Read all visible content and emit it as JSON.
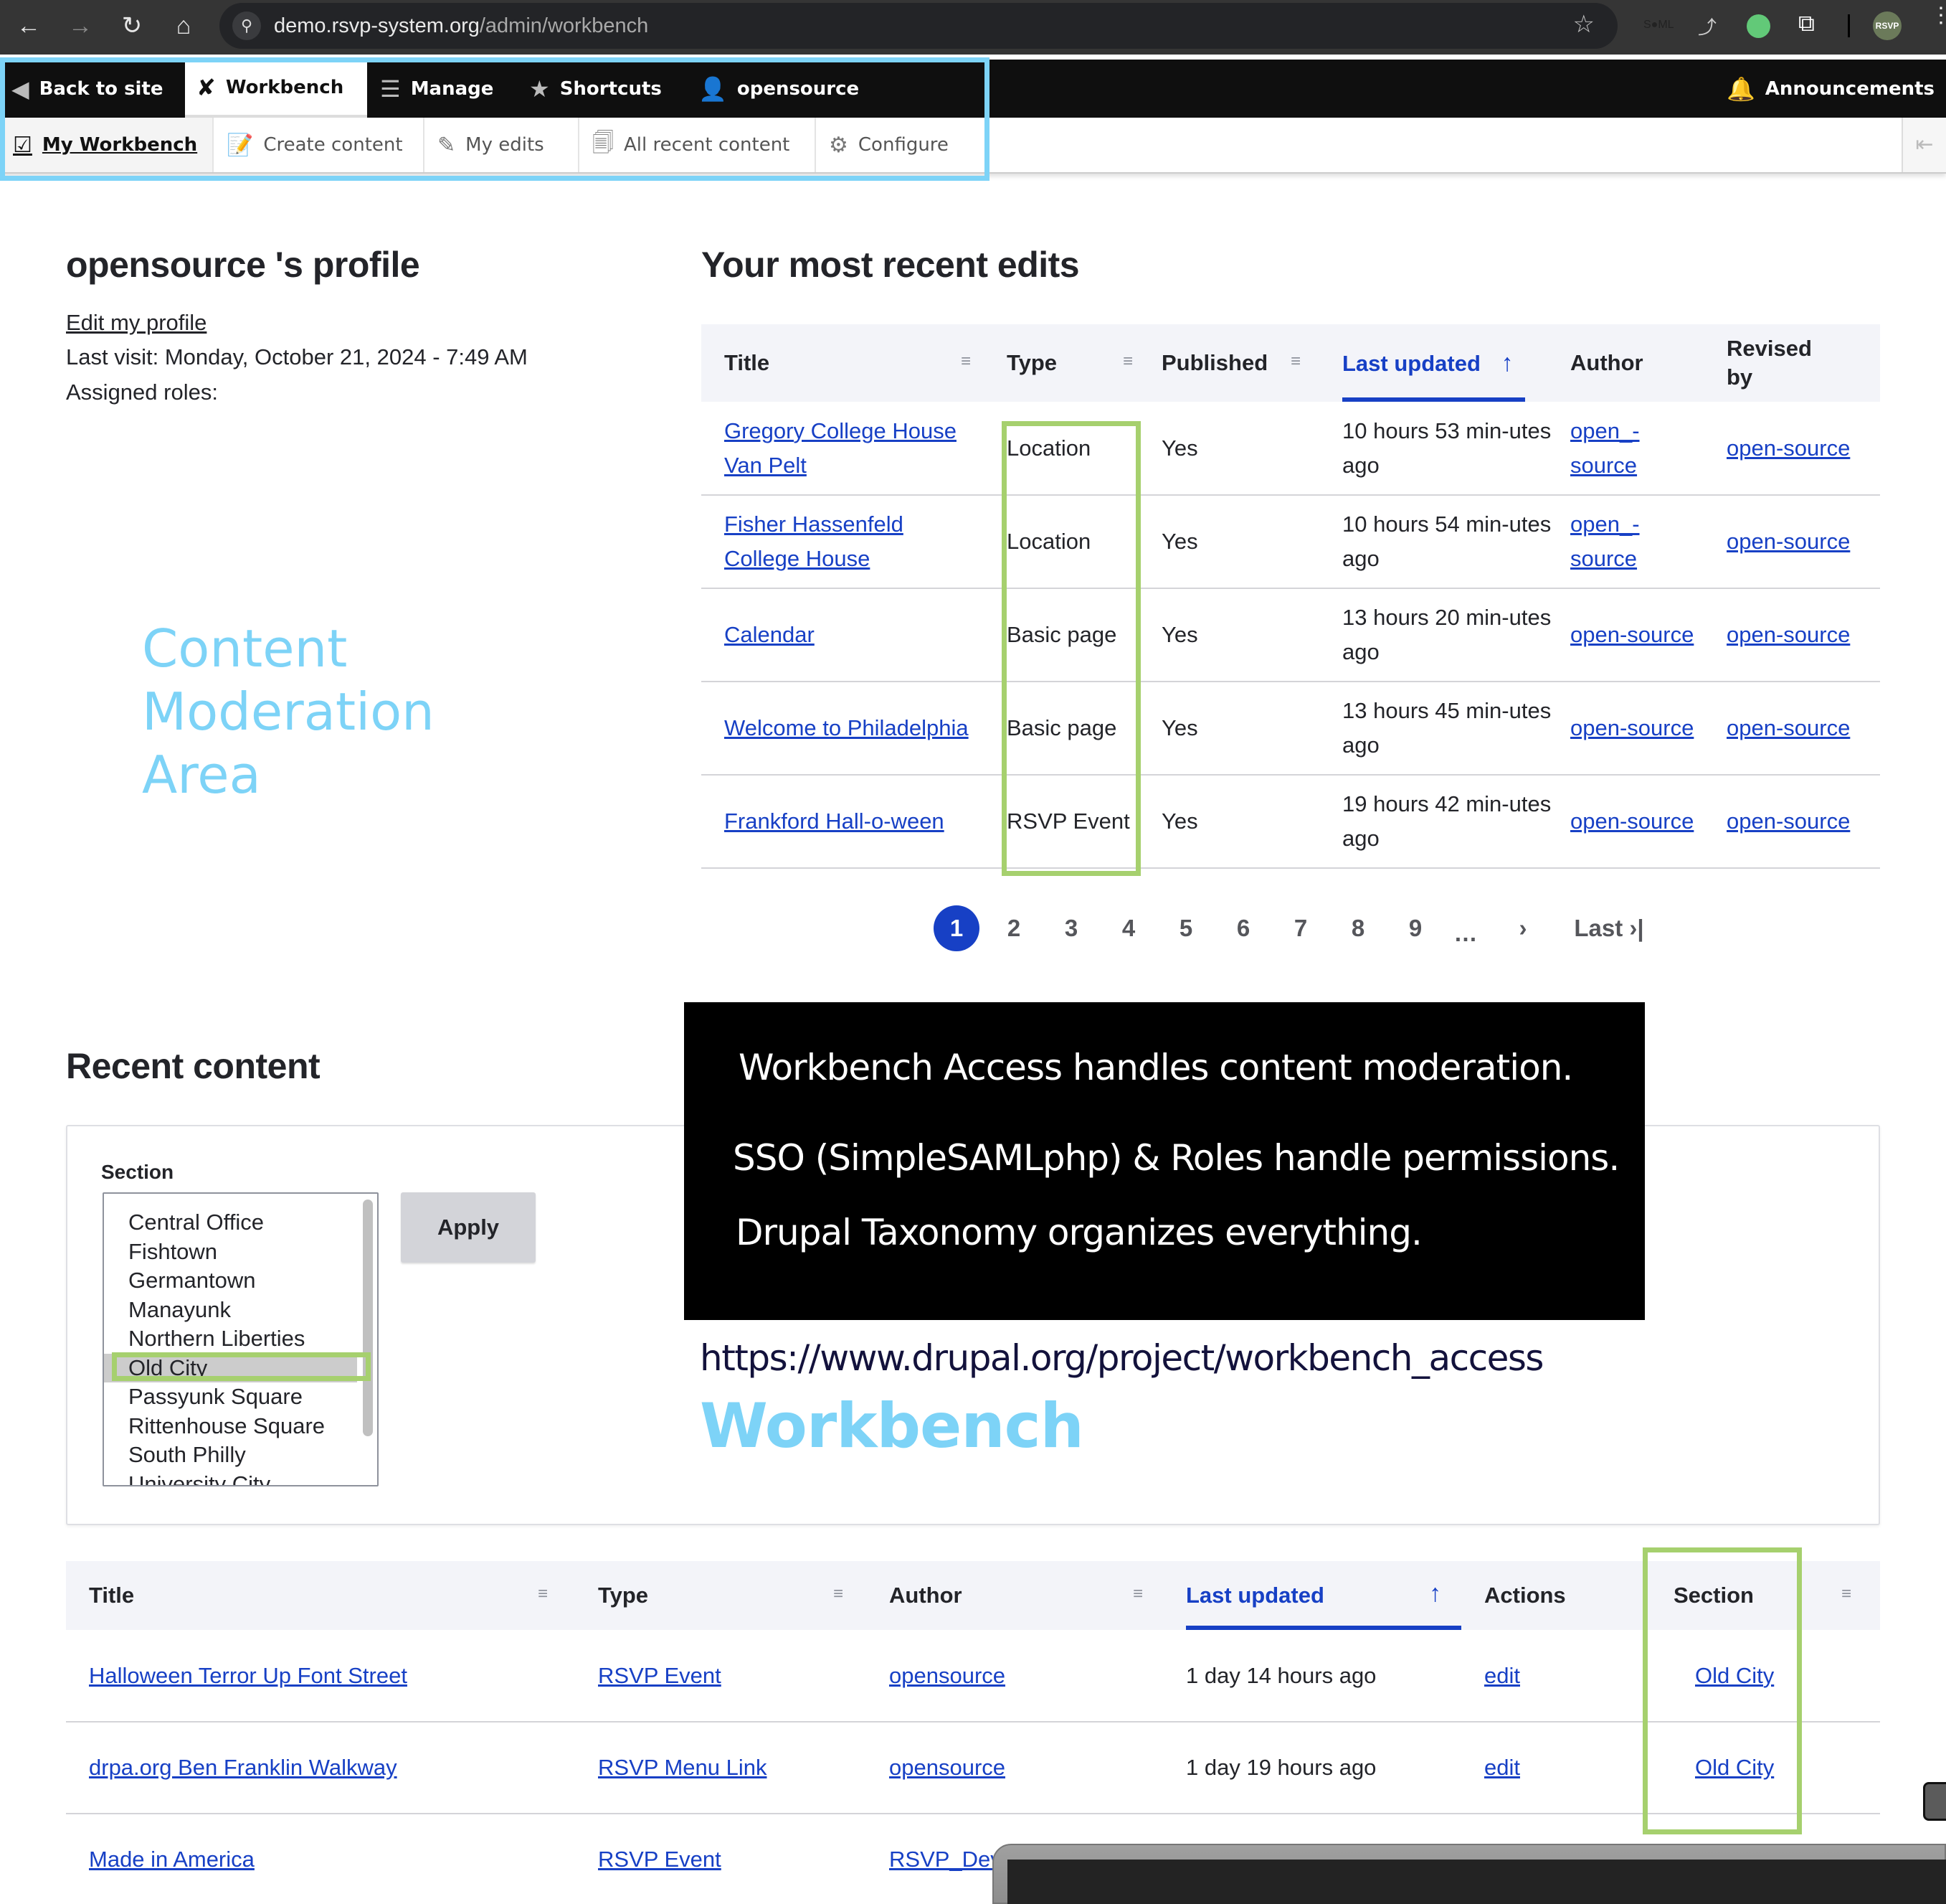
{
  "browser": {
    "url_host": "demo.rsvp-system.org",
    "url_path": "/admin/workbench",
    "extensions": [
      "saml-extension-icon",
      "graph-extension-icon",
      "green-status-icon",
      "puzzle-extensions-icon",
      "rsvp-profile-avatar"
    ],
    "profile_avatar_text": "RSVP"
  },
  "toolbar": {
    "items": [
      {
        "label": "Back to site",
        "icon": "back-circle-icon"
      },
      {
        "label": "Workbench",
        "icon": "tools-icon",
        "active": true
      },
      {
        "label": "Manage",
        "icon": "hamburger-icon"
      },
      {
        "label": "Shortcuts",
        "icon": "star-icon"
      },
      {
        "label": "opensource",
        "icon": "user-icon"
      }
    ],
    "announcements": "Announcements"
  },
  "tray": {
    "items": [
      {
        "label": "My Workbench",
        "active": true
      },
      {
        "label": "Create content"
      },
      {
        "label": "My edits"
      },
      {
        "label": "All recent content"
      },
      {
        "label": "Configure"
      }
    ]
  },
  "profile": {
    "title": "opensource 's profile",
    "edit_link": "Edit my profile",
    "last_visit": "Last visit: Monday, October 21, 2024 - 7:49 AM",
    "assigned_roles": "Assigned roles:"
  },
  "annotations": {
    "content_moderation": [
      "Content",
      "Moderation",
      "Area"
    ],
    "slide_lines": [
      "Workbench Access handles content moderation.",
      "SSO (SimpleSAMLphp) & Roles  handle permissions.",
      "Drupal Taxonomy organizes everything."
    ],
    "url": "https://www.drupal.org/project/workbench_access",
    "workbench_label": "Workbench",
    "colors": {
      "blue": "#7dd3f7",
      "green": "#a6d06e"
    }
  },
  "recent_edits": {
    "title": "Your most recent edits",
    "headers": {
      "title": "Title",
      "type": "Type",
      "published": "Published",
      "last_updated": "Last updated",
      "author": "Author",
      "revised_by": "Revised by"
    },
    "rows": [
      {
        "title": "Gregory College House Van Pelt",
        "type": "Location",
        "published": "Yes",
        "updated": "10 hours 53 min-utes ago",
        "author": "open_-source",
        "revised": "open-source"
      },
      {
        "title": "Fisher Hassenfeld College House",
        "type": "Location",
        "published": "Yes",
        "updated": "10 hours 54 min-utes ago",
        "author": "open_-source",
        "revised": "open-source"
      },
      {
        "title": "Calendar",
        "type": "Basic page",
        "published": "Yes",
        "updated": "13 hours 20 min-utes ago",
        "author": "open-source",
        "revised": "open-source"
      },
      {
        "title": "Welcome to Philadelphia",
        "type": "Basic page",
        "published": "Yes",
        "updated": "13 hours 45 min-utes ago",
        "author": "open-source",
        "revised": "open-source"
      },
      {
        "title": "Frankford Hall-o-ween",
        "type": "RSVP Event",
        "published": "Yes",
        "updated": "19 hours 42 min-utes ago",
        "author": "open-source",
        "revised": "open-source"
      }
    ],
    "pager": {
      "current": "1",
      "pages": [
        "2",
        "3",
        "4",
        "5",
        "6",
        "7",
        "8",
        "9"
      ],
      "ellipsis": "…",
      "next": "›",
      "last": "Last ›|"
    }
  },
  "recent_content": {
    "title": "Recent content",
    "filter": {
      "label": "Section",
      "options": [
        "Central Office",
        "Fishtown",
        "Germantown",
        "Manayunk",
        "Northern Liberties",
        "Old City",
        "Passyunk Square",
        "Rittenhouse Square",
        "South Philly",
        "University City"
      ],
      "selected": "Old City",
      "apply": "Apply"
    },
    "headers": {
      "title": "Title",
      "type": "Type",
      "author": "Author",
      "last_updated": "Last updated",
      "actions": "Actions",
      "section": "Section"
    },
    "rows": [
      {
        "title": "Halloween Terror Up Font Street",
        "type": "RSVP Event",
        "author": "opensource",
        "updated": "1 day 14 hours ago",
        "action": "edit",
        "section": "Old City"
      },
      {
        "title": "drpa.org Ben Franklin Walkway",
        "type": "RSVP Menu Link",
        "author": "opensource",
        "updated": "1 day 19 hours ago",
        "action": "edit",
        "section": "Old City"
      },
      {
        "title": "Made in America",
        "type": "RSVP Event",
        "author": "RSVP_Dev",
        "updated": "",
        "action": "",
        "section": ""
      }
    ]
  }
}
